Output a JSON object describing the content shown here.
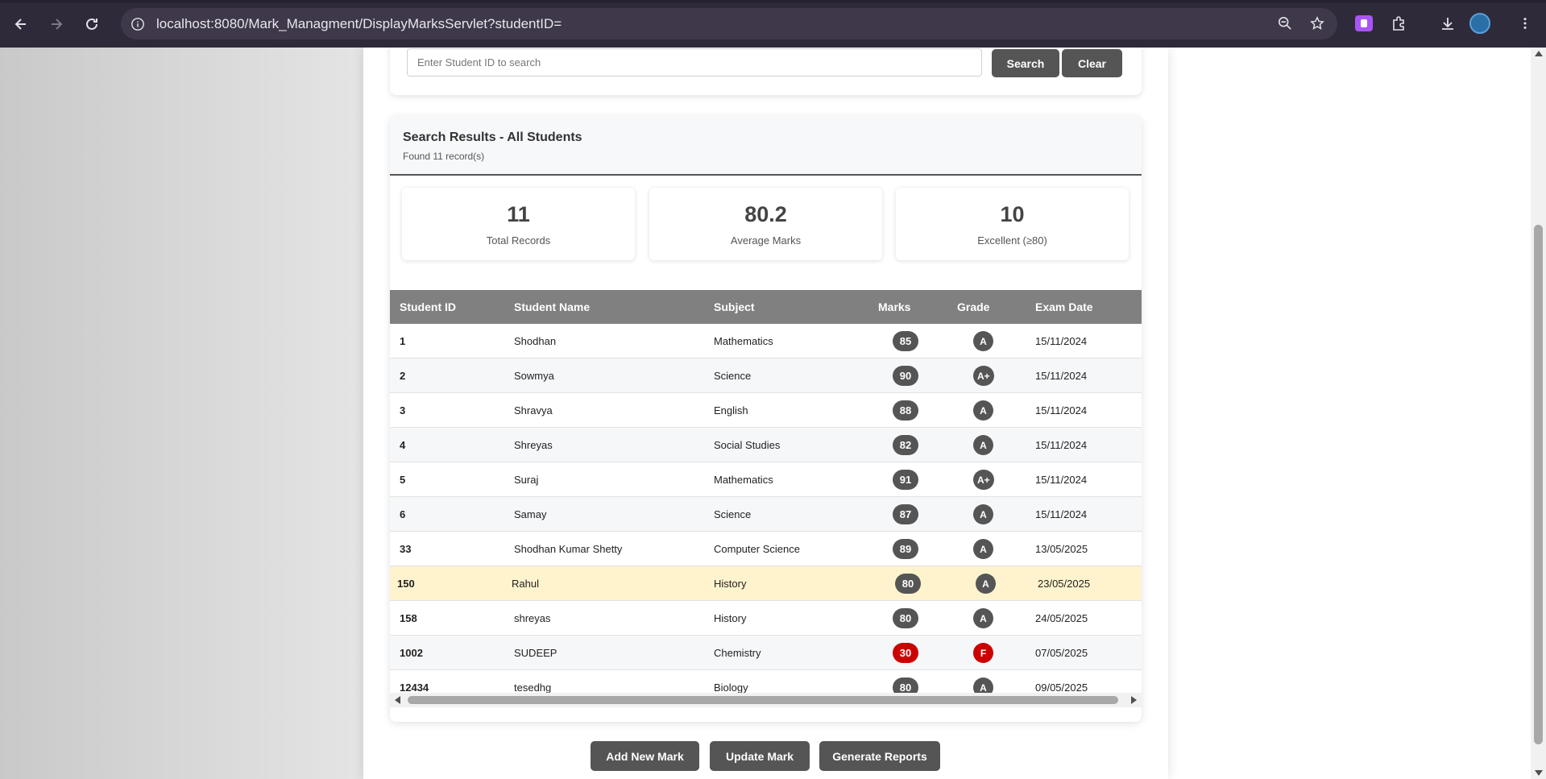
{
  "browser": {
    "url": "localhost:8080/Mark_Managment/DisplayMarksServlet?studentID="
  },
  "search": {
    "placeholder": "Enter Student ID to search",
    "search_label": "Search",
    "clear_label": "Clear"
  },
  "results": {
    "title": "Search Results - All Students",
    "subtitle": "Found 11 record(s)"
  },
  "stats": [
    {
      "value": "11",
      "label": "Total Records"
    },
    {
      "value": "80.2",
      "label": "Average Marks"
    },
    {
      "value": "10",
      "label": "Excellent (≥80)"
    }
  ],
  "table": {
    "headers": [
      "Student ID",
      "Student Name",
      "Subject",
      "Marks",
      "Grade",
      "Exam Date"
    ],
    "rows": [
      {
        "id": "1",
        "name": "Shodhan",
        "subject": "Mathematics",
        "marks": "85",
        "grade": "A",
        "date": "15/11/2024"
      },
      {
        "id": "2",
        "name": "Sowmya",
        "subject": "Science",
        "marks": "90",
        "grade": "A+",
        "date": "15/11/2024"
      },
      {
        "id": "3",
        "name": "Shravya",
        "subject": "English",
        "marks": "88",
        "grade": "A",
        "date": "15/11/2024"
      },
      {
        "id": "4",
        "name": "Shreyas",
        "subject": "Social Studies",
        "marks": "82",
        "grade": "A",
        "date": "15/11/2024"
      },
      {
        "id": "5",
        "name": "Suraj",
        "subject": "Mathematics",
        "marks": "91",
        "grade": "A+",
        "date": "15/11/2024"
      },
      {
        "id": "6",
        "name": "Samay",
        "subject": "Science",
        "marks": "87",
        "grade": "A",
        "date": "15/11/2024"
      },
      {
        "id": "33",
        "name": "Shodhan Kumar Shetty",
        "subject": "Computer Science",
        "marks": "89",
        "grade": "A",
        "date": "13/05/2025"
      },
      {
        "id": "150",
        "name": "Rahul",
        "subject": "History",
        "marks": "80",
        "grade": "A",
        "date": "23/05/2025"
      },
      {
        "id": "158",
        "name": "shreyas",
        "subject": "History",
        "marks": "80",
        "grade": "A",
        "date": "24/05/2025"
      },
      {
        "id": "1002",
        "name": "SUDEEP",
        "subject": "Chemistry",
        "marks": "30",
        "grade": "F",
        "date": "07/05/2025"
      },
      {
        "id": "12434",
        "name": "tesedhg",
        "subject": "Biology",
        "marks": "80",
        "grade": "A",
        "date": "09/05/2025"
      }
    ]
  },
  "actions": {
    "add_label": "Add New Mark",
    "update_label": "Update Mark",
    "reports_label": "Generate Reports"
  },
  "colors": {
    "badge": "#555555",
    "fail": "#cc0000",
    "highlight_row": "#fff3cd",
    "header": "#808080"
  }
}
